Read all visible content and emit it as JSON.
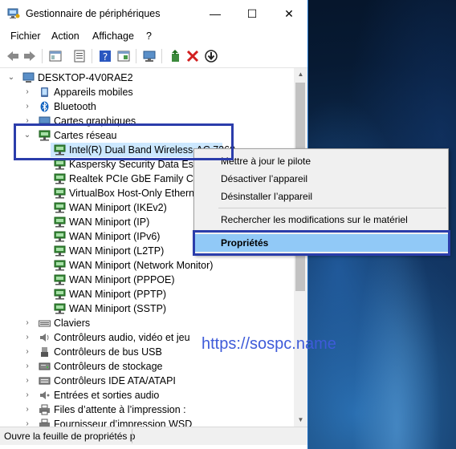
{
  "window": {
    "title": "Gestionnaire de périphériques",
    "controls": {
      "minimize": "—",
      "maximize": "☐",
      "close": "✕"
    }
  },
  "menu": [
    "Fichier",
    "Action",
    "Affichage",
    "?"
  ],
  "toolbar_icons": [
    "back-arrow-icon",
    "forward-arrow-icon",
    "console-tree-icon",
    "properties-sheet-icon",
    "help-icon",
    "show-hide-icon",
    "monitor-scan-icon",
    "update-driver-icon",
    "uninstall-x-icon",
    "disable-device-icon"
  ],
  "tree": {
    "root": "DESKTOP-4V0RAE2",
    "categories_before": [
      "Appareils mobiles",
      "Bluetooth",
      "Cartes graphiques"
    ],
    "network_category": "Cartes réseau",
    "network_adapters": [
      "Intel(R) Dual Band Wireless-AC 7260",
      "Kaspersky Security Data Escort Adapter",
      "Realtek PCIe GbE Family Controller",
      "VirtualBox Host-Only Ethernet Adapter",
      "WAN Miniport (IKEv2)",
      "WAN Miniport (IP)",
      "WAN Miniport (IPv6)",
      "WAN Miniport (L2TP)",
      "WAN Miniport (Network Monitor)",
      "WAN Miniport (PPPOE)",
      "WAN Miniport (PPTP)",
      "WAN Miniport (SSTP)"
    ],
    "categories_after": [
      "Claviers",
      "Contrôleurs audio, vidéo et jeu",
      "Contrôleurs de bus USB",
      "Contrôleurs de stockage",
      "Contrôleurs IDE ATA/ATAPI",
      "Entrées et sorties audio",
      "Files d’attente à l’impression :",
      "Fournisseur d’impression WSD"
    ]
  },
  "context_menu": {
    "update_driver": "Mettre à jour le pilote",
    "disable": "Désactiver l’appareil",
    "uninstall": "Désinstaller l’appareil",
    "scan": "Rechercher les modifications sur le matériel",
    "properties": "Propriétés"
  },
  "status": "Ouvre la feuille de propriétés p",
  "watermark": "https://sospc.name",
  "colors": {
    "highlight_border": "#2b3dab",
    "menu_hover": "#91c9f7",
    "selection": "#cce8ff"
  }
}
